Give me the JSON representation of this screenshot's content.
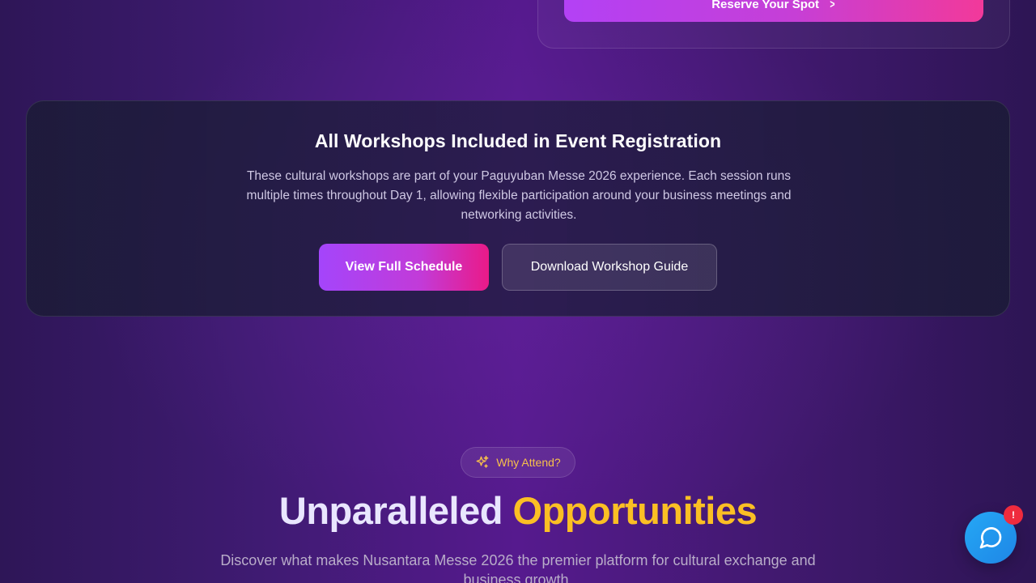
{
  "top_card": {
    "reserve_label": "Reserve Your Spot"
  },
  "workshops": {
    "title": "All Workshops Included in Event Registration",
    "description": "These cultural workshops are part of your Paguyuban Messe 2026 experience. Each session runs multiple times throughout Day 1, allowing flexible participation around your business meetings and networking activities.",
    "primary_button": "View Full Schedule",
    "secondary_button": "Download Workshop Guide"
  },
  "why_attend": {
    "badge_label": "Why Attend?",
    "badge_icon": "sparkles-icon",
    "headline_part1": "Unparalleled",
    "headline_part2": "Opportunities",
    "subtitle": "Discover what makes Nusantara Messe 2026 the premier platform for cultural exchange and business growth."
  },
  "chat": {
    "icon": "chat-bubble-icon",
    "badge": "!"
  },
  "colors": {
    "accent_gold": "#fbbf24",
    "gradient_start": "#a445fb",
    "gradient_end": "#ea1a88",
    "chat_blue": "#1e86e6",
    "alert_red": "#ef2b3d"
  }
}
